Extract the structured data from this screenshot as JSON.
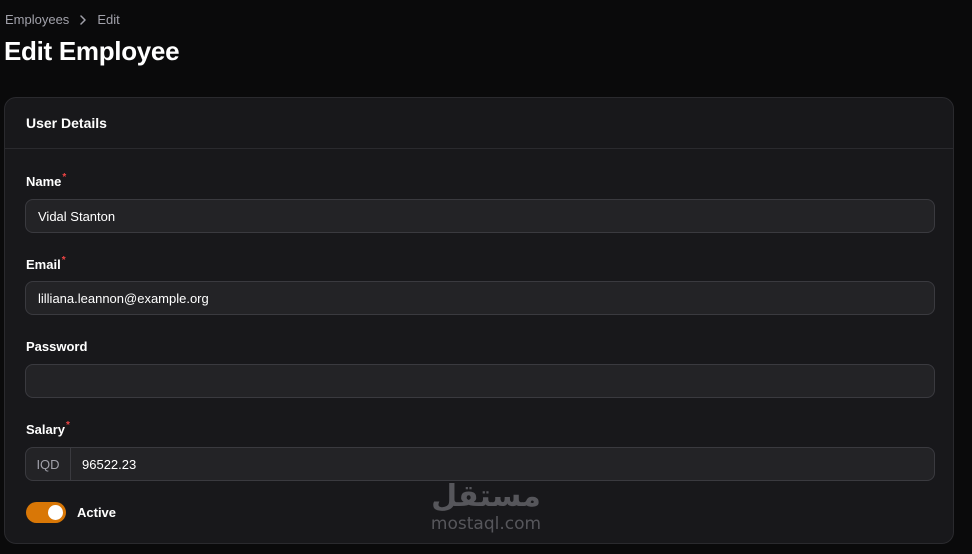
{
  "breadcrumb": {
    "items": [
      "Employees",
      "Edit"
    ]
  },
  "page": {
    "title": "Edit Employee"
  },
  "section": {
    "title": "User Details"
  },
  "form": {
    "name": {
      "label": "Name",
      "required": "*",
      "value": "Vidal Stanton"
    },
    "email": {
      "label": "Email",
      "required": "*",
      "value": "lilliana.leannon@example.org"
    },
    "password": {
      "label": "Password",
      "value": ""
    },
    "salary": {
      "label": "Salary",
      "required": "*",
      "prefix": "IQD",
      "value": "96522.23"
    },
    "active": {
      "label": "Active",
      "checked": true
    }
  },
  "watermark": {
    "arabic": "مستقل",
    "latin": "mostaql.com"
  },
  "colors": {
    "accent": "#d97706",
    "required": "#ef4444",
    "background": "#0a0a0b",
    "card": "#18181b"
  }
}
